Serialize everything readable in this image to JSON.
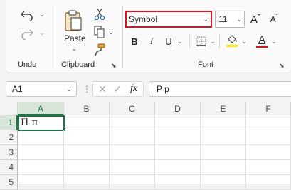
{
  "ribbon": {
    "undo_group": {
      "label": "Undo"
    },
    "clipboard_group": {
      "label": "Clipboard",
      "paste_label": "Paste"
    },
    "font_group": {
      "label": "Font",
      "font_name": "Symbol",
      "font_size": "11",
      "bold": "B",
      "italic": "I",
      "underline": "U",
      "grow": "A",
      "shrink": "A",
      "font_color_letter": "A",
      "highlight_color": "#ffe600",
      "font_color": "#e0121a"
    }
  },
  "formula_bar": {
    "name_box": "A1",
    "fx": "fx",
    "content": "P p"
  },
  "sheet": {
    "columns": [
      "A",
      "B",
      "C",
      "D",
      "E",
      "F"
    ],
    "rows": [
      "1",
      "2",
      "3",
      "4",
      "5"
    ],
    "active_cell_value": "Π π",
    "accent": "#217346"
  }
}
